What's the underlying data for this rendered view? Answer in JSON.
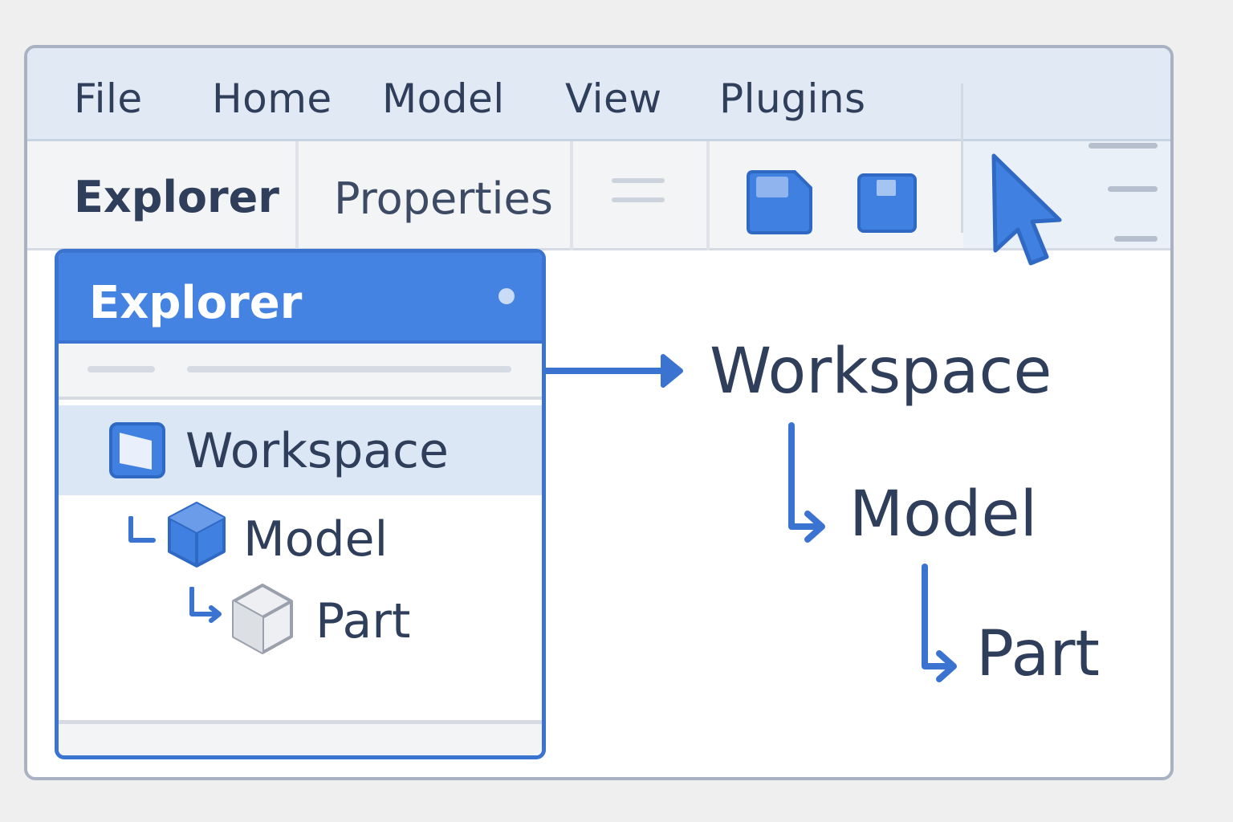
{
  "menubar": {
    "items": [
      {
        "label": "File"
      },
      {
        "label": "Home"
      },
      {
        "label": "Model"
      },
      {
        "label": "View"
      },
      {
        "label": "Plugins"
      }
    ]
  },
  "toolbar": {
    "tabs": [
      {
        "label": "Explorer",
        "active": true
      },
      {
        "label": "Properties",
        "active": false
      }
    ],
    "icons": [
      "grip-icon",
      "save-icon",
      "save-small-icon",
      "cursor-icon",
      "menu-lines-icon"
    ]
  },
  "explorer": {
    "title": "Explorer",
    "tree": [
      {
        "label": "Workspace",
        "icon": "workspace-icon",
        "selected": true
      },
      {
        "label": "Model",
        "icon": "model-cube-icon",
        "selected": false
      },
      {
        "label": "Part",
        "icon": "part-cube-icon",
        "selected": false
      }
    ]
  },
  "hierarchy": {
    "nodes": [
      "Workspace",
      "Model",
      "Part"
    ]
  },
  "colors": {
    "accent": "#4483e2",
    "accent_dark": "#3a74d0",
    "text": "#2f3e5a",
    "selection": "#dce7f6",
    "menubar_bg": "#e1e9f5"
  }
}
